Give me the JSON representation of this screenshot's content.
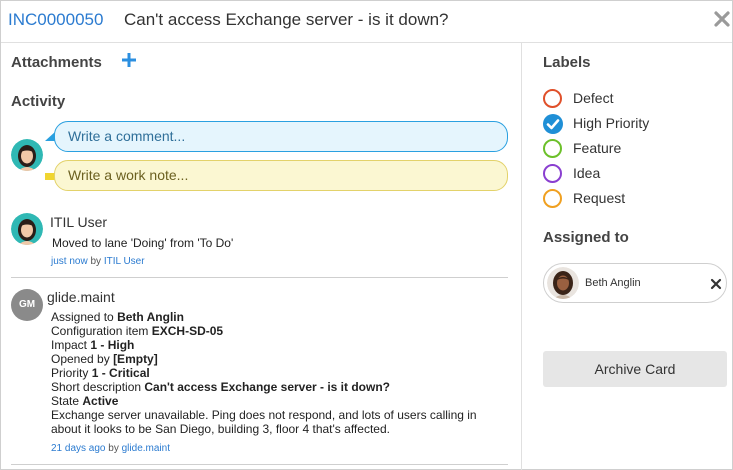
{
  "header": {
    "number": "INC0000050",
    "title": "Can't access Exchange server - is it down?"
  },
  "sections": {
    "attachments": "Attachments",
    "activity": "Activity",
    "labels": "Labels",
    "assigned_to": "Assigned to"
  },
  "composer": {
    "comment_placeholder": "Write a comment...",
    "worknote_placeholder": "Write a work note..."
  },
  "activity": [
    {
      "author": "ITIL User",
      "text": "Moved to lane 'Doing' from 'To Do'",
      "time": "just now",
      "by": "by",
      "by_user": "ITIL User"
    },
    {
      "author": "glide.maint",
      "initials": "GM",
      "lines": [
        {
          "label": "Assigned to",
          "value": "Beth Anglin"
        },
        {
          "label": "Configuration item",
          "value": "EXCH-SD-05"
        },
        {
          "label": "Impact",
          "value": "1 - High"
        },
        {
          "label": "Opened by",
          "value": "[Empty]"
        },
        {
          "label": "Priority",
          "value": "1 - Critical"
        },
        {
          "label": "Short description",
          "value": "Can't access Exchange server - is it down?"
        },
        {
          "label": "State",
          "value": "Active"
        }
      ],
      "note_1": "Exchange server unavailable. Ping does not respond, and lots of users calling in",
      "note_2": "about it looks to be San Diego, building 3, floor 4 that's affected.",
      "time": "21 days ago",
      "by": "by",
      "by_user": "glide.maint"
    }
  ],
  "labels": [
    {
      "name": "Defect",
      "color": "#e0502a",
      "checked": false
    },
    {
      "name": "High Priority",
      "color": "#1f8fd6",
      "checked": true
    },
    {
      "name": "Feature",
      "color": "#6cc02a",
      "checked": false
    },
    {
      "name": "Idea",
      "color": "#8a3fd0",
      "checked": false
    },
    {
      "name": "Request",
      "color": "#f0a020",
      "checked": false
    }
  ],
  "assignee": {
    "name": "Beth Anglin"
  },
  "archive_label": "Archive Card"
}
